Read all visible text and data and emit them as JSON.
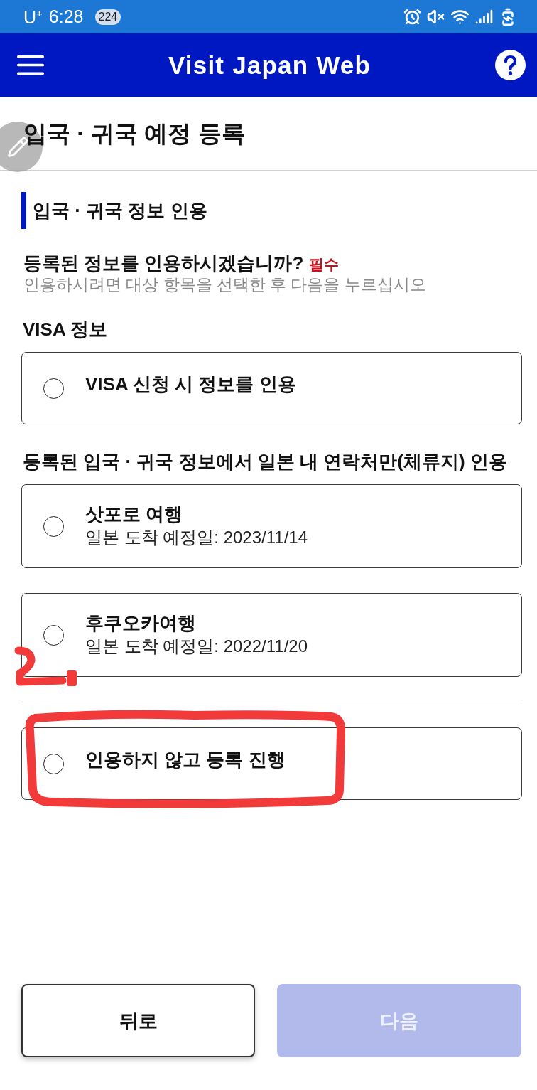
{
  "status_bar": {
    "carrier": "U$^{+}$",
    "time": "6:28",
    "notification_count": "224"
  },
  "app_bar": {
    "title": "Visit Japan Web"
  },
  "page": {
    "title": "입국 · 귀국 예정 등록"
  },
  "section": {
    "heading": "입국 · 귀국 정보 인용",
    "question": {
      "label": "등록된 정보를 인용하시겠습니까?",
      "required": "필수",
      "hint": "인용하시려면 대상 항목을 선택한 후 다음을 누르십시오"
    },
    "groups": [
      {
        "label": "VISA 정보",
        "options": [
          {
            "title": "VISA 신청 시 정보를 인용",
            "selected": false,
            "marked": false
          }
        ]
      },
      {
        "label": "등록된 입국 · 귀국 정보에서 일본 내 연락처만(체류지) 인용",
        "options": [
          {
            "title": "삿포로 여행",
            "subtitle": "일본 도착 예정일: 2023/11/14",
            "selected": false,
            "marked": false
          },
          {
            "title": "후쿠오카여행",
            "subtitle": "일본 도착 예정일: 2022/11/20",
            "selected": false,
            "marked": true
          }
        ]
      }
    ],
    "standalone_option": {
      "title": "인용하지 않고 등록 진행",
      "selected": false,
      "circled": true
    }
  },
  "buttons": [
    {
      "kind": "back",
      "label": "뒤로",
      "disabled": false
    },
    {
      "kind": "next",
      "label": "다음",
      "disabled": true
    }
  ]
}
